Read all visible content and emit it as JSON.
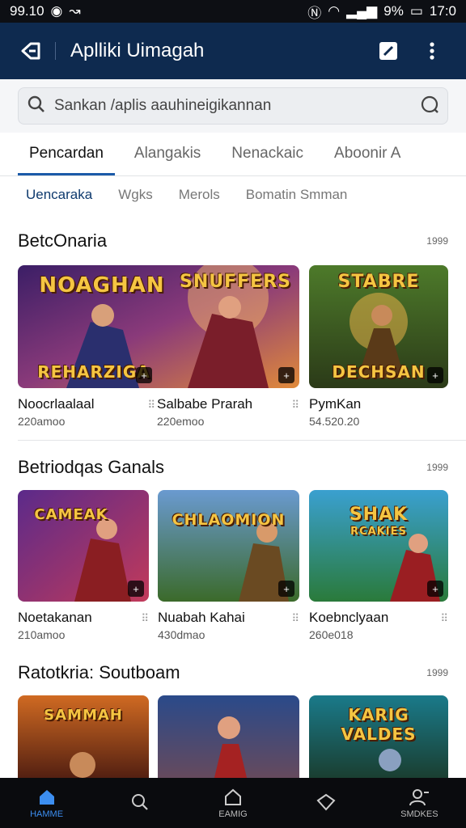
{
  "status": {
    "time": "99.10",
    "battery": "9%",
    "clock": "17:0"
  },
  "appbar": {
    "title": "Aplliki Uimagah",
    "back_icon": "back-arrow-icon",
    "edit_icon": "edit-icon",
    "more_icon": "more-vert-icon"
  },
  "search": {
    "placeholder": "Sankan /aplis aauhineigikannan"
  },
  "tabs": [
    "Pencardan",
    "Alangakis",
    "Nenackaic",
    "Aboonir A"
  ],
  "chips": [
    "Uencaraka",
    "Wgks",
    "Merols",
    "Bomatin Smman"
  ],
  "sections": [
    {
      "title": "BetcOnaria",
      "more": "1999",
      "items": [
        {
          "name": "Noocrlaalaal",
          "sub": "220amoo",
          "art": "NOAGHAN",
          "art2": "REHARZIGA",
          "opt": "⠿"
        },
        {
          "name": "Salbabe Prarah",
          "sub": "220emoo",
          "art": "SNUFFERS",
          "art2": "",
          "opt": "⠿"
        },
        {
          "name": "PymKan",
          "sub": "54.520.20",
          "art": "STABRE",
          "art2": "DECHSAN",
          "opt": ""
        }
      ]
    },
    {
      "title": "Betriodqas Ganals",
      "more": "1999",
      "items": [
        {
          "name": "Noetakanan",
          "sub": "210amoo",
          "art": "CAMEAK",
          "art2": "",
          "opt": "⠿"
        },
        {
          "name": "Nuabah Kahai",
          "sub": "430dmao",
          "art": "CHLAOMION",
          "art2": "",
          "opt": "⠿"
        },
        {
          "name": "Koebnclyaan",
          "sub": "260e018",
          "art": "SHAK",
          "art2": "RCAKIES",
          "opt": "⠿"
        }
      ]
    },
    {
      "title": "Ratotkria: Soutboam",
      "more": "1999",
      "items": [
        {
          "name": "",
          "sub": "",
          "art": "SAMMAH",
          "art2": "",
          "opt": ""
        },
        {
          "name": "",
          "sub": "",
          "art": "",
          "art2": "",
          "opt": ""
        },
        {
          "name": "",
          "sub": "",
          "art": "KARIG",
          "art2": "VALDES",
          "opt": ""
        }
      ]
    }
  ],
  "nav": [
    {
      "label": "HAMME",
      "icon": "home-icon"
    },
    {
      "label": "",
      "icon": "search-icon"
    },
    {
      "label": "EAMIG",
      "icon": "house-outline-icon"
    },
    {
      "label": "",
      "icon": "chat-icon"
    },
    {
      "label": "SMDKES",
      "icon": "profile-icon"
    }
  ],
  "colors": {
    "appbar": "#0e2a4f",
    "accent": "#1b5aa8",
    "nav_active": "#3c8ef0"
  }
}
